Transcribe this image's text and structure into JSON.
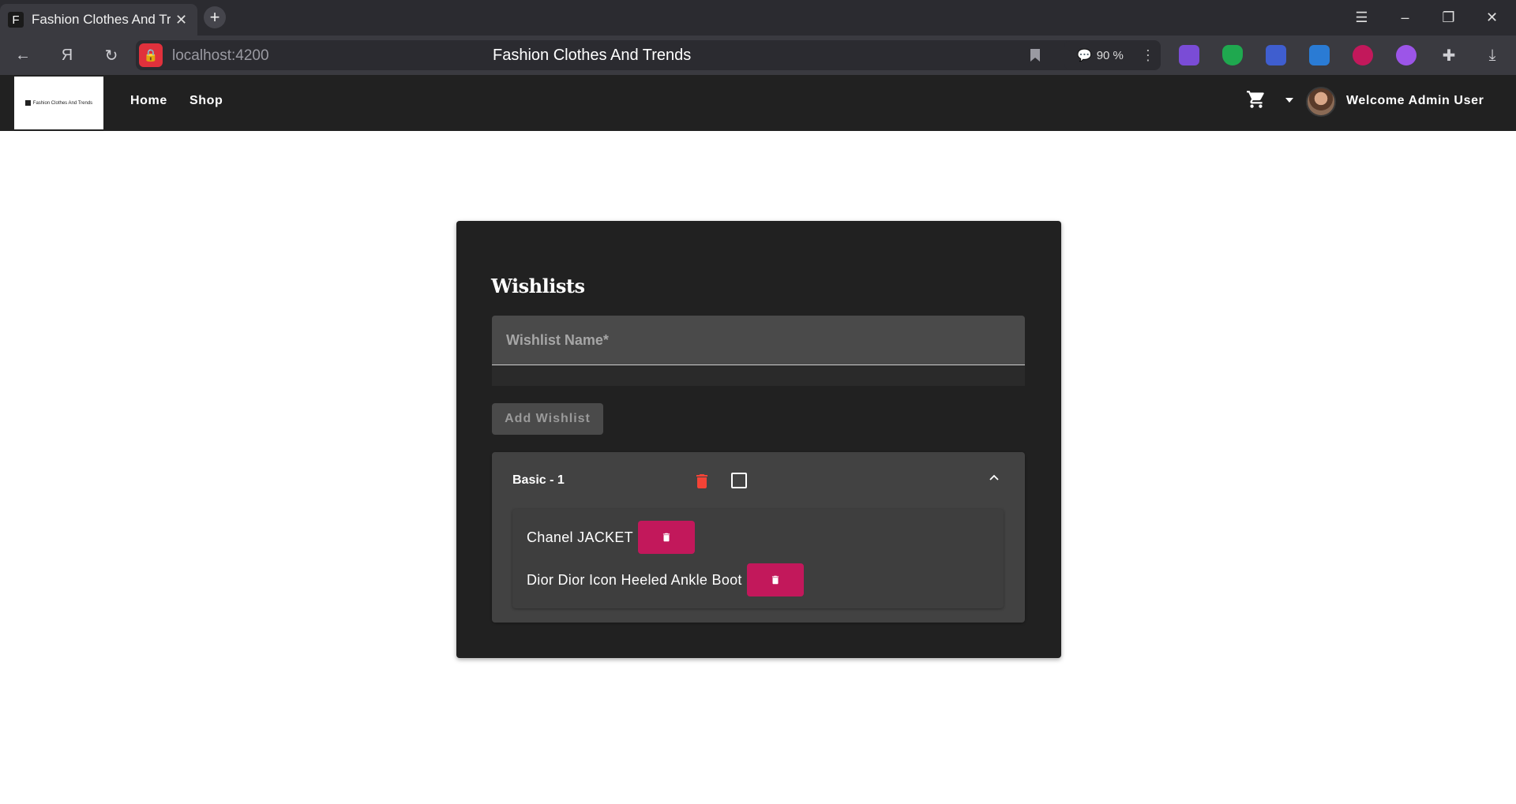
{
  "browser": {
    "tab": {
      "favicon": "F",
      "title": "Fashion Clothes And Trends"
    },
    "url": "localhost:4200",
    "page_title": "Fashion Clothes And Trends",
    "zoom": "90 %"
  },
  "header": {
    "logo_text": "Fashion Clothes And Trends",
    "nav": [
      {
        "label": "Home"
      },
      {
        "label": "Shop"
      }
    ],
    "welcome": "Welcome Admin User"
  },
  "wishlists": {
    "title": "Wishlists",
    "input_placeholder": "Wishlist Name*",
    "add_button": "Add Wishlist",
    "lists": [
      {
        "name": "Basic - 1",
        "expanded": true,
        "items": [
          {
            "name": "Chanel JACKET"
          },
          {
            "name": "Dior Dior Icon Heeled Ankle Boot"
          }
        ]
      }
    ]
  },
  "colors": {
    "header_bg": "#212121",
    "card_bg": "#212121",
    "panel_bg": "#424242",
    "delete_accent": "#c2185b",
    "delete_icon": "#f44336"
  }
}
